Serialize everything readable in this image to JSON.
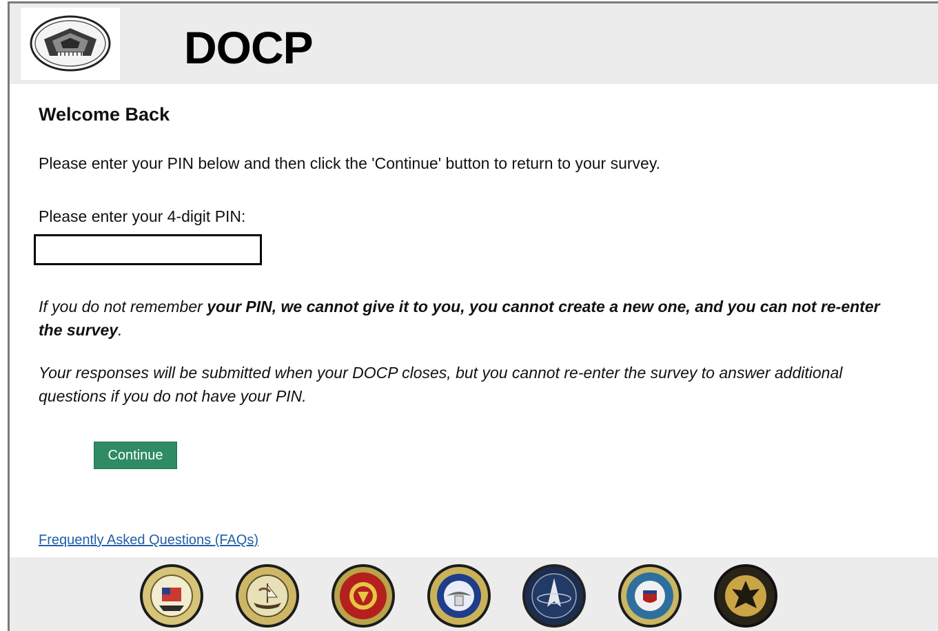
{
  "header": {
    "app_title": "DOCP",
    "logo_icon": "pentagon-seal-icon"
  },
  "main": {
    "welcome": "Welcome Back",
    "instructions": "Please enter your PIN below and then click the 'Continue' button to return to your survey.",
    "pin_label": "Please enter your 4-digit PIN:",
    "pin_value": "",
    "warning_lead": "If you do not remember ",
    "warning_bold": "your PIN, we cannot give it to you, you cannot create a new one, and you can not re-enter the survey",
    "warning_end": ".",
    "note": "Your responses will be submitted when your DOCP closes, but you cannot re-enter the survey to answer additional questions if you do not have your PIN.",
    "continue_label": "Continue",
    "faq_link": "Frequently Asked Questions (FAQs)"
  },
  "footer": {
    "seals": [
      "army-seal-icon",
      "navy-seal-icon",
      "marine-corps-seal-icon",
      "air-force-seal-icon",
      "space-force-seal-icon",
      "coast-guard-seal-icon",
      "national-guard-seal-icon"
    ]
  },
  "colors": {
    "header_bg": "#ececec",
    "continue_bg": "#2e8b64",
    "link": "#1f5fa8"
  }
}
